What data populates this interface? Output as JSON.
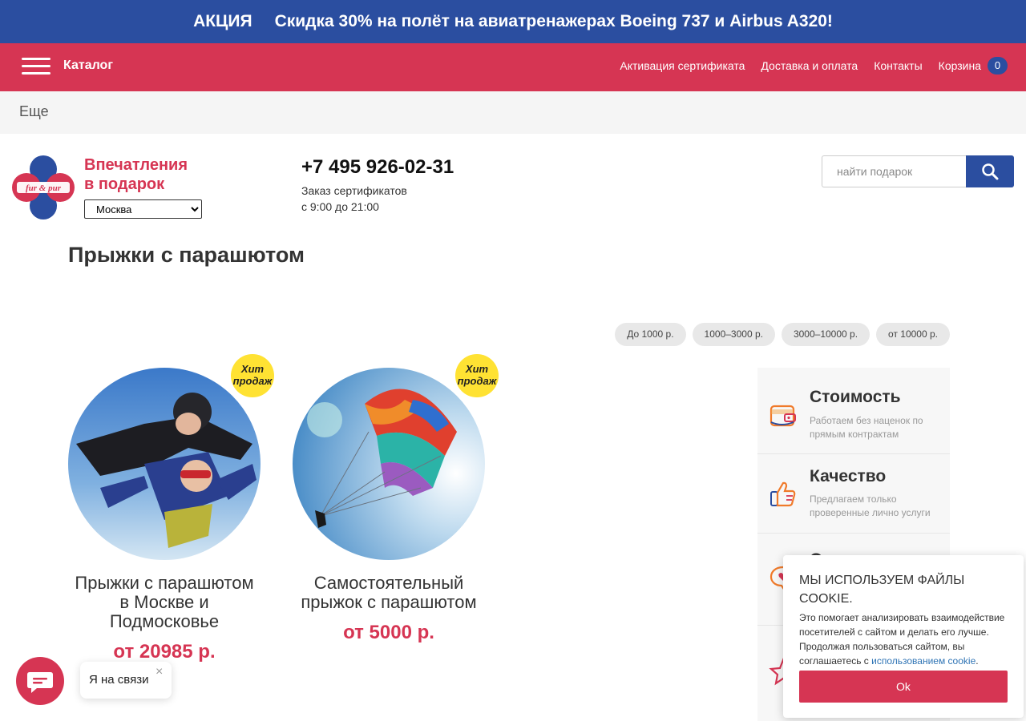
{
  "promo": {
    "tag": "АКЦИЯ",
    "text": "Скидка 30% на полёт на авиатренажерах Boeing 737 и Airbus A320!"
  },
  "nav": {
    "catalog_label": "Каталог",
    "links": [
      "Активация сертификата",
      "Доставка и оплата",
      "Контакты",
      "Корзина"
    ],
    "cart_count": "0"
  },
  "more_label": "Еще",
  "header": {
    "logo_text": "fur & pur",
    "brand_line1": "Впечатления",
    "brand_line2": "в подарок",
    "city": "Москва",
    "phone": "+7 495 926-02-31",
    "hours_line1": "Заказ сертификатов",
    "hours_line2": "с 9:00 до 21:00",
    "search_placeholder": "найти подарок"
  },
  "page_title": "Прыжки с парашютом",
  "price_filters": [
    "До 1000 р.",
    "1000–3000 р.",
    "3000–10000 р.",
    "от 10000 р."
  ],
  "products": [
    {
      "badge_line1": "Хит",
      "badge_line2": "продаж",
      "name": "Прыжки с парашютом в Москве и Подмосковье",
      "price": "от 20985 р."
    },
    {
      "badge_line1": "Хит",
      "badge_line2": "продаж",
      "name": "Самостоятельный прыжок с парашютом",
      "price": "от 5000 р."
    }
  ],
  "advantages": [
    {
      "title": "Стоимость",
      "desc": "Работаем без наценок по прямым контрактам",
      "icon": "wallet-icon"
    },
    {
      "title": "Качество",
      "desc": "Предлагаем только проверенные лично услуги",
      "icon": "thumbs-up-icon"
    },
    {
      "title": "Отношение",
      "desc": "",
      "icon": "chat-heart-icon"
    },
    {
      "title": "",
      "desc": "",
      "icon": "star-icon"
    }
  ],
  "cookie": {
    "title": "МЫ ИСПОЛЬЗУЕМ ФАЙЛЫ COOKIE.",
    "text": "Это помогает анализировать взаимодействие посетителей с сайтом и делать его лучше. Продолжая пользоваться сайтом, вы соглашаетесь с",
    "link": "использованием cookie",
    "ok_label": "Ok"
  },
  "chat": {
    "bubble_text": "Я на связи",
    "close_symbol": "×"
  },
  "colors": {
    "brand_red": "#d63553",
    "brand_blue": "#2b4ea0",
    "badge_yellow": "#ffe233"
  }
}
